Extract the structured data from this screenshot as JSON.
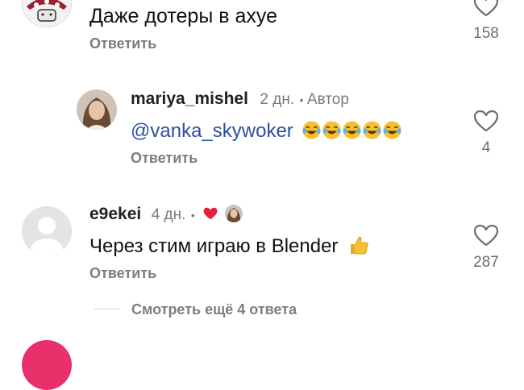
{
  "comments": [
    {
      "id": "top",
      "text": "Даже дотеры в ахуе",
      "reply_label": "Ответить",
      "like_count": "158"
    },
    {
      "id": "mariya",
      "username": "mariya_mishel",
      "time": "2 дн.",
      "dot": "•",
      "author_badge": "Автор",
      "mention_symbol": "@",
      "mention_text": "vanka_skywoker",
      "emoji": [
        "laughing-tears",
        "laughing-tears",
        "laughing-tears",
        "laughing-tears",
        "laughing-tears"
      ],
      "reply_label": "Ответить",
      "like_count": "4"
    },
    {
      "id": "e9ekei",
      "username": "e9ekei",
      "time": "4 дн.",
      "dot": "•",
      "creator_liked_icon": "heart-filled-icon",
      "text": "Через стим играю в Blender",
      "trailing_emoji": "thumbs-up",
      "reply_label": "Ответить",
      "like_count": "287"
    }
  ],
  "view_more_label": "Смотреть ещё 4 ответа",
  "colors": {
    "mention": "#2c4f9e",
    "heart_red": "#e41e3f",
    "secondary_text": "#7d7d7d"
  }
}
